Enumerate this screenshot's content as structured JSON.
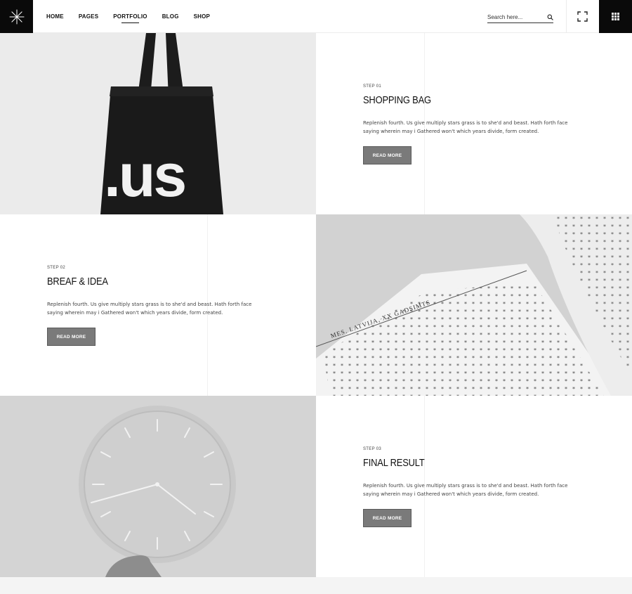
{
  "nav": {
    "items": [
      {
        "label": "HOME"
      },
      {
        "label": "PAGES"
      },
      {
        "label": "PORTFOLIO",
        "active": true
      },
      {
        "label": "BLOG"
      },
      {
        "label": "SHOP"
      }
    ]
  },
  "search": {
    "placeholder": "Search here..."
  },
  "icons": {
    "logo": "asterisk-logo",
    "search": "search-icon",
    "expand": "fullscreen-icon",
    "menu": "grid-menu-icon"
  },
  "colors": {
    "dark": "#0a0a0a",
    "button": "#7a7a7a",
    "footer": "#f4f4f4"
  },
  "steps": [
    {
      "step": "STEP 01",
      "title": "SHOPPING BAG",
      "desc": "Replenish fourth. Us give multiply stars grass is to she'd and beast. Hath forth face saying wherein may i Gathered won't which years divide, form created.",
      "button": "READ MORE",
      "image": {
        "bag_text": ".us"
      }
    },
    {
      "step": "STEP 02",
      "title": "BREAF & IDEA",
      "desc": "Replenish fourth. Us give multiply stars grass is to she'd and beast. Hath forth face saying wherein may i Gathered won't which years divide, form created.",
      "button": "READ MORE",
      "image": {
        "book_caption": "Mes. Latvija, XX gadsimts"
      }
    },
    {
      "step": "STEP 03",
      "title": "FINAL RESULT",
      "desc": "Replenish fourth. Us give multiply stars grass is to she'd and beast. Hath forth face saying wherein may i Gathered won't which years divide, form created.",
      "button": "READ MORE"
    }
  ]
}
